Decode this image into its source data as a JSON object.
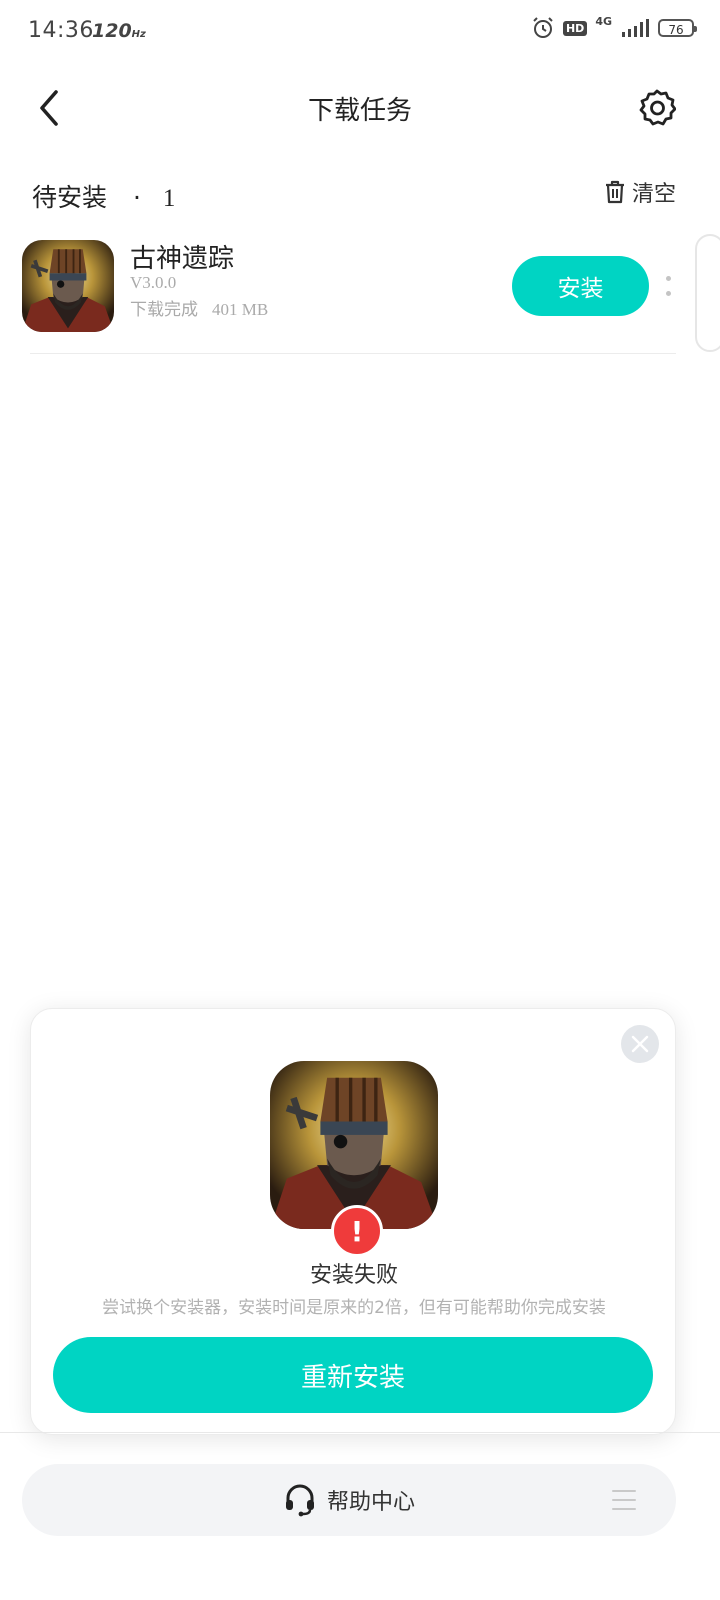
{
  "status_bar": {
    "time": "14:36",
    "refresh_rate": "120",
    "refresh_unit": "Hz",
    "network": "4G",
    "hd": "HD",
    "battery": "76"
  },
  "header": {
    "title": "下载任务",
    "back_icon": "chevron-left-icon",
    "settings_icon": "gear-icon"
  },
  "section": {
    "title": "待安装",
    "separator": "·",
    "count": "1",
    "clear_label": "清空",
    "clear_icon": "trash-icon"
  },
  "download_item": {
    "name": "古神遗踪",
    "version": "V3.0.0",
    "status": "下载完成",
    "size": "401 MB",
    "action_label": "安装"
  },
  "dialog": {
    "title": "安装失败",
    "description": "尝试换个安装器，安装时间是原来的2倍，但有可能帮助你完成安装",
    "alert_symbol": "!",
    "button_label": "重新安装",
    "close_icon": "close-icon"
  },
  "bottom": {
    "help_label": "帮助中心",
    "help_icon": "headset-icon",
    "menu_icon": "menu-icon"
  },
  "colors": {
    "accent": "#00d4c3",
    "error": "#ef3b3b",
    "muted_text": "#aaaaaa"
  }
}
